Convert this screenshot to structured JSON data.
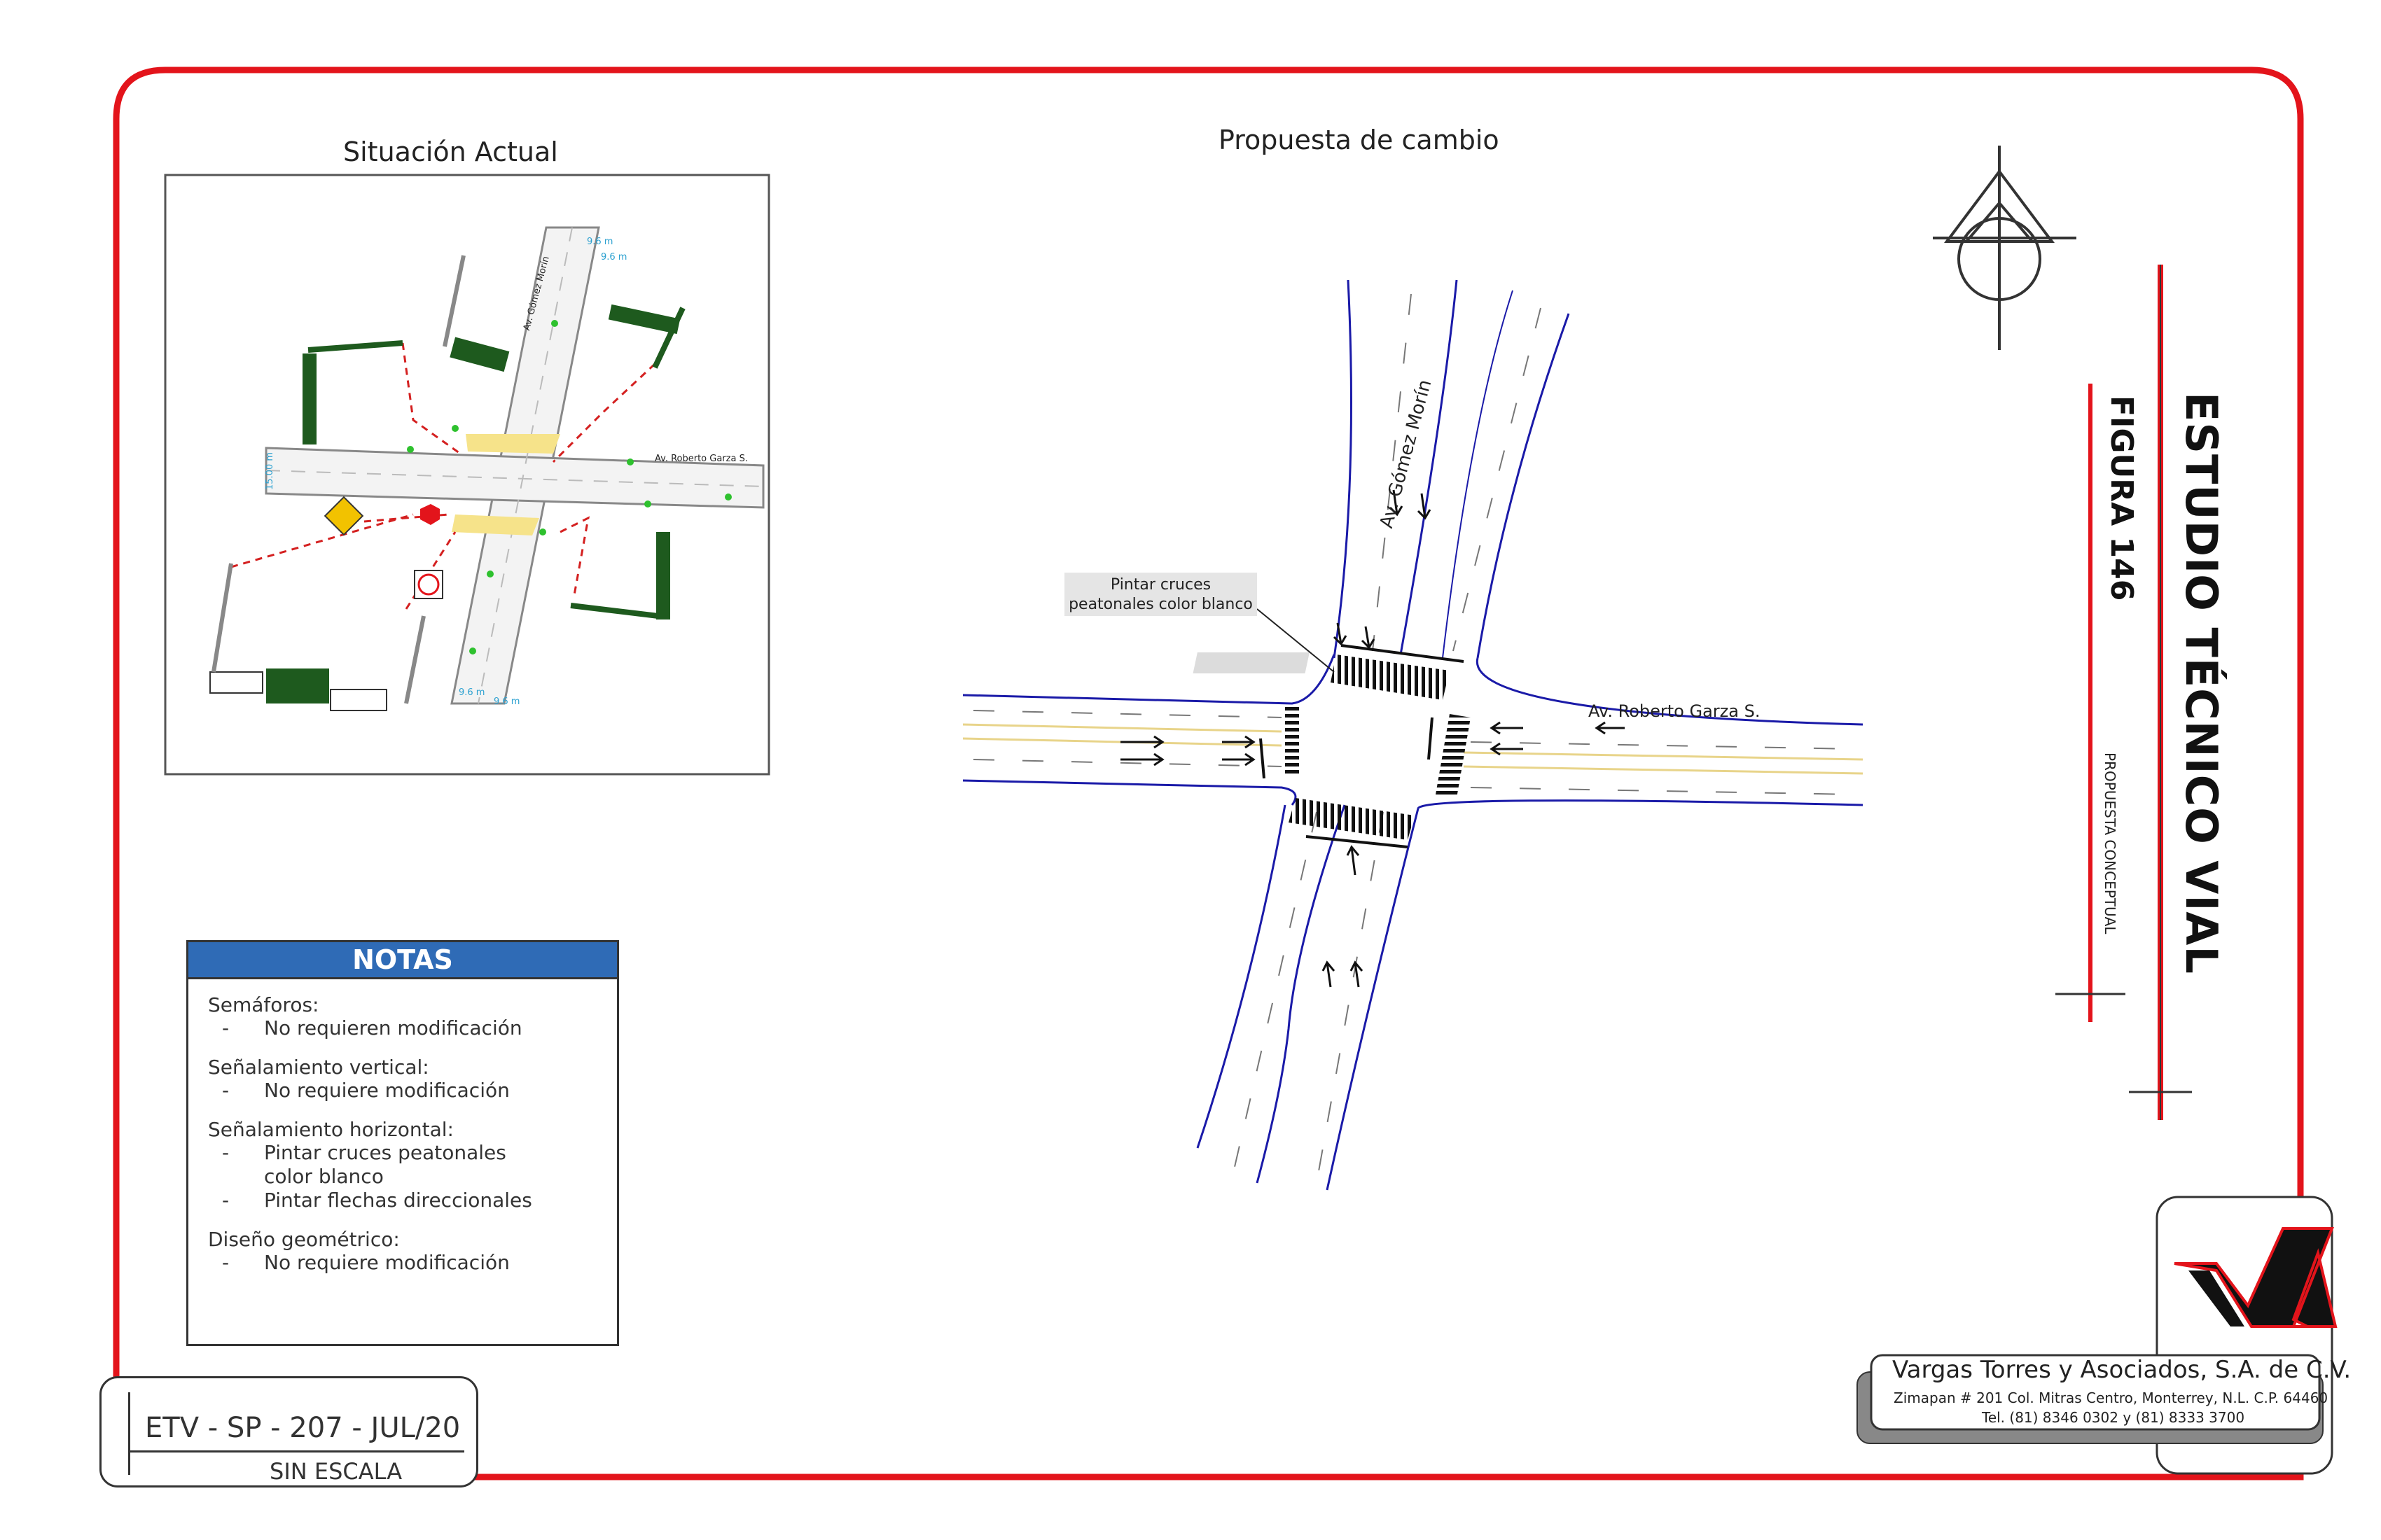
{
  "titles": {
    "current": "Situación Actual",
    "proposal": "Propuesta de cambio"
  },
  "sheet": {
    "study": "ESTUDIO TÉCNICO VIAL",
    "figure": "FIGURA 146",
    "concept": "PROPUESTA CONCEPTUAL"
  },
  "streets": {
    "ns": "Av. Gómez Morín",
    "ew": "Av. Roberto Garza S."
  },
  "current_plan": {
    "street_ns": "Av. Gómez Morín",
    "street_ew": "Av. Roberto Garza S.",
    "dim_ns_a": "9.6 m",
    "dim_ns_b": "9.6 m",
    "dim_ns_c": "9.6 m",
    "dim_ns_d": "9.6 m",
    "dim_ew": "15.00 m"
  },
  "callout": {
    "line1": "Pintar cruces",
    "line2": "peatonales color blanco"
  },
  "notes": {
    "header": "NOTAS",
    "groups": [
      {
        "title": "Semáforos:",
        "items": [
          "No requieren modificación"
        ]
      },
      {
        "title": "Señalamiento vertical:",
        "items": [
          "No requiere modificación"
        ]
      },
      {
        "title": "Señalamiento horizontal:",
        "items": [
          "Pintar cruces peatonales color blanco",
          "Pintar flechas direccionales"
        ]
      },
      {
        "title": "Diseño geométrico:",
        "items": [
          "No requiere modificación"
        ]
      }
    ]
  },
  "code": "ETV - SP - 207 - JUL/20",
  "scale": "SIN ESCALA",
  "company": {
    "name": "Vargas Torres y Asociados, S.A. de C.V.",
    "address": "Zimapan # 201 Col. Mitras Centro, Monterrey, N.L. C.P. 64460",
    "tel": "Tel. (81) 8346 0302  y  (81) 8333 3700"
  },
  "colors": {
    "frame_red": "#e3141b",
    "road_blue": "#1a1aa8",
    "header_blue": "#2f6bb6",
    "sign_green": "#1e5a1e"
  }
}
